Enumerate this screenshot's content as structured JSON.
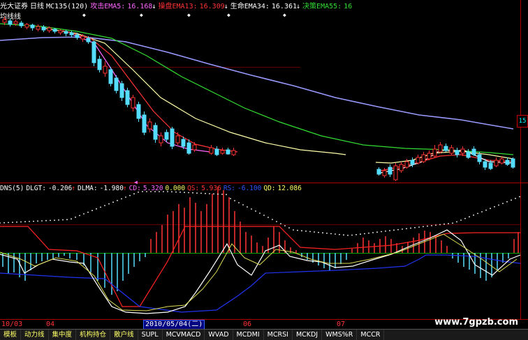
{
  "header": {
    "stock": "光大证券",
    "period": "日线",
    "indicator": "MC135(120)",
    "attack_label": "攻击EMA5:",
    "attack_value": "16.168",
    "attack_arrow": "↓",
    "operate_label": "操盘EMA13:",
    "operate_value": "16.309",
    "operate_arrow": "↓",
    "life_label": "生命EMA34:",
    "life_value": "16.361",
    "life_arrow": "↓",
    "decision_label": "决策EMA55:",
    "decision_value": "16"
  },
  "sub_label": "均线线",
  "price_tag": "15",
  "sub_header": {
    "name": "DNS(5)",
    "dlgt_label": "DLGT:",
    "dlgt_value": "-0.206",
    "dlgt_arrow": "↑",
    "dlma_label": "DLMA:",
    "dlma_value": "-1.980",
    "dlma_arrow": "↑",
    "cd_label": "CD:",
    "cd_value": "5.320",
    "v2": "0.000",
    "qs_label": "QS:",
    "qs_value": "5.936",
    "rs_label": "RS:",
    "rs_value": "-6.100",
    "qd_label": "QD:",
    "qd_value": "12.086"
  },
  "axis": {
    "m1": "10/03",
    "m2": "04",
    "selected_date": "2010/05/04(二)",
    "m3": "06",
    "m4": "07"
  },
  "tabs": [
    {
      "label": "模板",
      "en": false
    },
    {
      "label": "动力线",
      "en": false
    },
    {
      "label": "集中度",
      "en": false
    },
    {
      "label": "机构持仓",
      "en": false
    },
    {
      "label": "散户线",
      "en": false
    },
    {
      "label": "SUPL",
      "en": true
    },
    {
      "label": "MCVMACD",
      "en": true
    },
    {
      "label": "WVAD",
      "en": true
    },
    {
      "label": "MCDMI",
      "en": true
    },
    {
      "label": "MCRSI",
      "en": true
    },
    {
      "label": "MCKDJ",
      "en": true
    },
    {
      "label": "WMS%R",
      "en": true
    },
    {
      "label": "MCCR",
      "en": true
    }
  ],
  "watermark": "www.7gpzb.com",
  "colors": {
    "up": "#ff3333",
    "down": "#55ddff",
    "ema5": "#ff66ff",
    "ema13": "#ff3333",
    "ema34": "#ffffaa",
    "ema55": "#33dd33",
    "ema120": "#9999ff"
  }
}
